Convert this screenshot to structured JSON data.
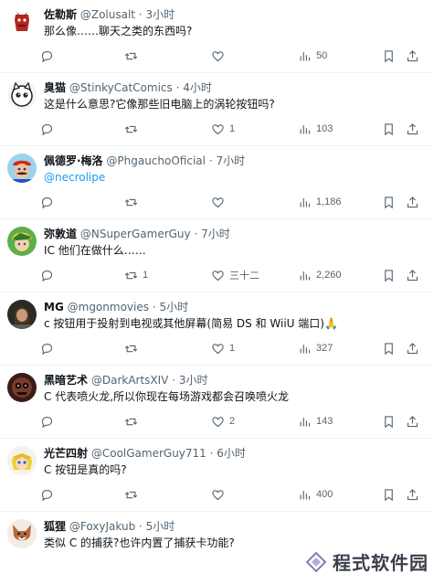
{
  "replies": [
    {
      "name": "佐勒斯",
      "handle": "@Zolusalt",
      "time": "· 3小时",
      "text": "那么像……聊天之类的东西吗?",
      "replies": "",
      "retweets": "",
      "likes": "",
      "views": "50",
      "avatar_icon": "red-creature-avatar"
    },
    {
      "name": "臭猫",
      "handle": "@StinkyCatComics",
      "time": "· 4小时",
      "text": "这是什么意思?它像那些旧电脑上的涡轮按钮吗?",
      "replies": "",
      "retweets": "",
      "likes": "1",
      "views": "103",
      "avatar_icon": "cartoon-cat-avatar"
    },
    {
      "name": "佩德罗·梅洛",
      "handle": "@PhgauchoOficial",
      "time": "· 7小时",
      "text": "@necrolipe",
      "replies": "",
      "retweets": "",
      "likes": "",
      "views": "1,186",
      "avatar_icon": "mario-avatar"
    },
    {
      "name": "弥敦道",
      "handle": "@NSuperGamerGuy",
      "time": "· 7小时",
      "text": "IC 他们在做什么……",
      "replies": "",
      "retweets": "1",
      "likes": "三十二",
      "views": "2,260",
      "avatar_icon": "green-hero-avatar"
    },
    {
      "name": "MG",
      "handle": "@mgonmovies",
      "time": "· 5小时",
      "text": "c 按钮用于投射到电视或其他屏幕(简易 DS 和 WiiU 端口)🙏",
      "replies": "",
      "retweets": "",
      "likes": "1",
      "views": "327",
      "avatar_icon": "person-avatar"
    },
    {
      "name": "黑暗艺术",
      "handle": "@DarkArtsXIV",
      "time": "· 3小时",
      "text": "C 代表喷火龙,所以你现在每场游戏都会召唤喷火龙",
      "replies": "",
      "retweets": "",
      "likes": "2",
      "views": "143",
      "avatar_icon": "dark-mask-avatar"
    },
    {
      "name": "光芒四射",
      "handle": "@CoolGamerGuy711",
      "time": "· 6小时",
      "text": "C 按钮是真的吗?",
      "replies": "",
      "retweets": "",
      "likes": "",
      "views": "400",
      "avatar_icon": "blonde-character-avatar"
    },
    {
      "name": "狐狸",
      "handle": "@FoxyJakub",
      "time": "· 5小时",
      "text": "类似 C 的捕获?也许内置了捕获卡功能?",
      "replies": "",
      "retweets": "",
      "likes": "",
      "views": "",
      "avatar_icon": "fox-avatar"
    }
  ],
  "watermark": {
    "text": "程式软件园"
  },
  "colors": {
    "accent": "#1d9bf0",
    "muted": "#536471",
    "text": "#0f1419",
    "divider": "#eff3f4"
  }
}
